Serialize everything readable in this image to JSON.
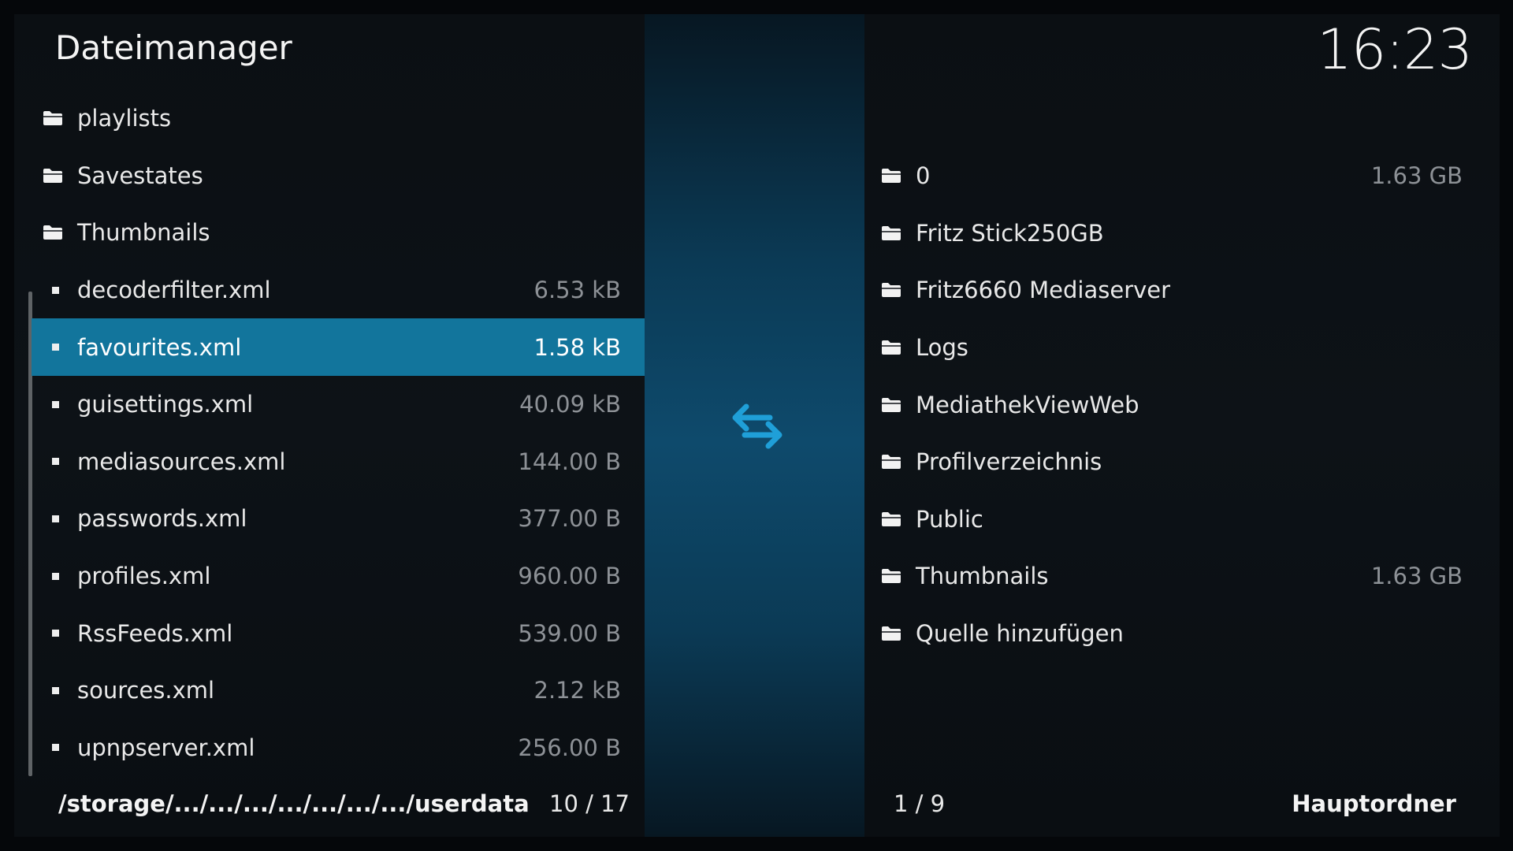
{
  "window": {
    "title": "Dateimanager",
    "clock": "16:23"
  },
  "colors": {
    "accent": "#12759c",
    "swap_icon": "#1f9fd8"
  },
  "left_panel": {
    "items": [
      {
        "type": "folder",
        "name": "playlists",
        "size": ""
      },
      {
        "type": "folder",
        "name": "Savestates",
        "size": ""
      },
      {
        "type": "folder",
        "name": "Thumbnails",
        "size": ""
      },
      {
        "type": "file",
        "name": "decoderfilter.xml",
        "size": "6.53 kB"
      },
      {
        "type": "file",
        "name": "favourites.xml",
        "size": "1.58 kB",
        "selected": true
      },
      {
        "type": "file",
        "name": "guisettings.xml",
        "size": "40.09 kB"
      },
      {
        "type": "file",
        "name": "mediasources.xml",
        "size": "144.00 B"
      },
      {
        "type": "file",
        "name": "passwords.xml",
        "size": "377.00 B"
      },
      {
        "type": "file",
        "name": "profiles.xml",
        "size": "960.00 B"
      },
      {
        "type": "file",
        "name": "RssFeeds.xml",
        "size": "539.00 B"
      },
      {
        "type": "file",
        "name": "sources.xml",
        "size": "2.12 kB"
      },
      {
        "type": "file",
        "name": "upnpserver.xml",
        "size": "256.00 B"
      }
    ],
    "path": "/storage/.../.../.../.../.../.../.../userdata",
    "count": "10 / 17"
  },
  "center": {
    "icon": "swap-arrows-icon"
  },
  "right_panel": {
    "items": [
      {
        "type": "folder",
        "name": "0",
        "size": "1.63 GB"
      },
      {
        "type": "folder",
        "name": "Fritz Stick250GB",
        "size": ""
      },
      {
        "type": "folder",
        "name": "Fritz6660 Mediaserver",
        "size": ""
      },
      {
        "type": "folder",
        "name": "Logs",
        "size": ""
      },
      {
        "type": "folder",
        "name": "MediathekViewWeb",
        "size": ""
      },
      {
        "type": "folder",
        "name": "Profilverzeichnis",
        "size": ""
      },
      {
        "type": "folder",
        "name": "Public",
        "size": ""
      },
      {
        "type": "folder",
        "name": "Thumbnails",
        "size": "1.63 GB"
      },
      {
        "type": "folder",
        "name": "Quelle hinzufügen",
        "size": ""
      }
    ],
    "count": "1 / 9",
    "footer_label": "Hauptordner"
  }
}
